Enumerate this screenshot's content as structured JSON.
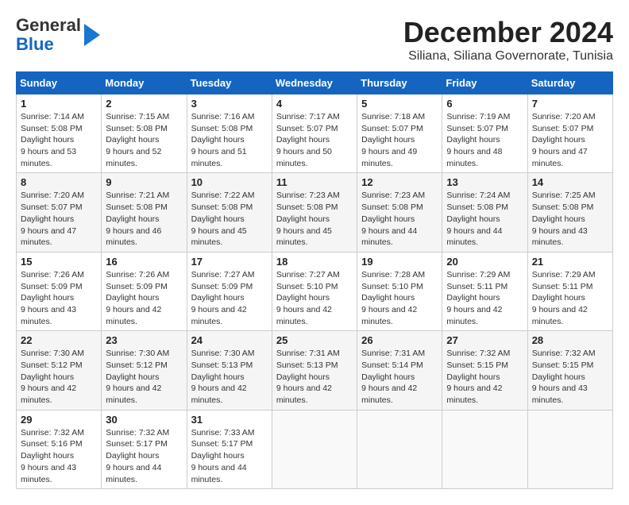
{
  "header": {
    "logo_line1": "General",
    "logo_line2": "Blue",
    "title": "December 2024",
    "subtitle": "Siliana, Siliana Governorate, Tunisia"
  },
  "calendar": {
    "days_of_week": [
      "Sunday",
      "Monday",
      "Tuesday",
      "Wednesday",
      "Thursday",
      "Friday",
      "Saturday"
    ],
    "weeks": [
      [
        {
          "day": "1",
          "sunrise": "7:14 AM",
          "sunset": "5:08 PM",
          "daylight": "9 hours and 53 minutes."
        },
        {
          "day": "2",
          "sunrise": "7:15 AM",
          "sunset": "5:08 PM",
          "daylight": "9 hours and 52 minutes."
        },
        {
          "day": "3",
          "sunrise": "7:16 AM",
          "sunset": "5:08 PM",
          "daylight": "9 hours and 51 minutes."
        },
        {
          "day": "4",
          "sunrise": "7:17 AM",
          "sunset": "5:07 PM",
          "daylight": "9 hours and 50 minutes."
        },
        {
          "day": "5",
          "sunrise": "7:18 AM",
          "sunset": "5:07 PM",
          "daylight": "9 hours and 49 minutes."
        },
        {
          "day": "6",
          "sunrise": "7:19 AM",
          "sunset": "5:07 PM",
          "daylight": "9 hours and 48 minutes."
        },
        {
          "day": "7",
          "sunrise": "7:20 AM",
          "sunset": "5:07 PM",
          "daylight": "9 hours and 47 minutes."
        }
      ],
      [
        {
          "day": "8",
          "sunrise": "7:20 AM",
          "sunset": "5:07 PM",
          "daylight": "9 hours and 47 minutes."
        },
        {
          "day": "9",
          "sunrise": "7:21 AM",
          "sunset": "5:08 PM",
          "daylight": "9 hours and 46 minutes."
        },
        {
          "day": "10",
          "sunrise": "7:22 AM",
          "sunset": "5:08 PM",
          "daylight": "9 hours and 45 minutes."
        },
        {
          "day": "11",
          "sunrise": "7:23 AM",
          "sunset": "5:08 PM",
          "daylight": "9 hours and 45 minutes."
        },
        {
          "day": "12",
          "sunrise": "7:23 AM",
          "sunset": "5:08 PM",
          "daylight": "9 hours and 44 minutes."
        },
        {
          "day": "13",
          "sunrise": "7:24 AM",
          "sunset": "5:08 PM",
          "daylight": "9 hours and 44 minutes."
        },
        {
          "day": "14",
          "sunrise": "7:25 AM",
          "sunset": "5:08 PM",
          "daylight": "9 hours and 43 minutes."
        }
      ],
      [
        {
          "day": "15",
          "sunrise": "7:26 AM",
          "sunset": "5:09 PM",
          "daylight": "9 hours and 43 minutes."
        },
        {
          "day": "16",
          "sunrise": "7:26 AM",
          "sunset": "5:09 PM",
          "daylight": "9 hours and 42 minutes."
        },
        {
          "day": "17",
          "sunrise": "7:27 AM",
          "sunset": "5:09 PM",
          "daylight": "9 hours and 42 minutes."
        },
        {
          "day": "18",
          "sunrise": "7:27 AM",
          "sunset": "5:10 PM",
          "daylight": "9 hours and 42 minutes."
        },
        {
          "day": "19",
          "sunrise": "7:28 AM",
          "sunset": "5:10 PM",
          "daylight": "9 hours and 42 minutes."
        },
        {
          "day": "20",
          "sunrise": "7:29 AM",
          "sunset": "5:11 PM",
          "daylight": "9 hours and 42 minutes."
        },
        {
          "day": "21",
          "sunrise": "7:29 AM",
          "sunset": "5:11 PM",
          "daylight": "9 hours and 42 minutes."
        }
      ],
      [
        {
          "day": "22",
          "sunrise": "7:30 AM",
          "sunset": "5:12 PM",
          "daylight": "9 hours and 42 minutes."
        },
        {
          "day": "23",
          "sunrise": "7:30 AM",
          "sunset": "5:12 PM",
          "daylight": "9 hours and 42 minutes."
        },
        {
          "day": "24",
          "sunrise": "7:30 AM",
          "sunset": "5:13 PM",
          "daylight": "9 hours and 42 minutes."
        },
        {
          "day": "25",
          "sunrise": "7:31 AM",
          "sunset": "5:13 PM",
          "daylight": "9 hours and 42 minutes."
        },
        {
          "day": "26",
          "sunrise": "7:31 AM",
          "sunset": "5:14 PM",
          "daylight": "9 hours and 42 minutes."
        },
        {
          "day": "27",
          "sunrise": "7:32 AM",
          "sunset": "5:15 PM",
          "daylight": "9 hours and 42 minutes."
        },
        {
          "day": "28",
          "sunrise": "7:32 AM",
          "sunset": "5:15 PM",
          "daylight": "9 hours and 43 minutes."
        }
      ],
      [
        {
          "day": "29",
          "sunrise": "7:32 AM",
          "sunset": "5:16 PM",
          "daylight": "9 hours and 43 minutes."
        },
        {
          "day": "30",
          "sunrise": "7:32 AM",
          "sunset": "5:17 PM",
          "daylight": "9 hours and 44 minutes."
        },
        {
          "day": "31",
          "sunrise": "7:33 AM",
          "sunset": "5:17 PM",
          "daylight": "9 hours and 44 minutes."
        },
        null,
        null,
        null,
        null
      ]
    ]
  }
}
